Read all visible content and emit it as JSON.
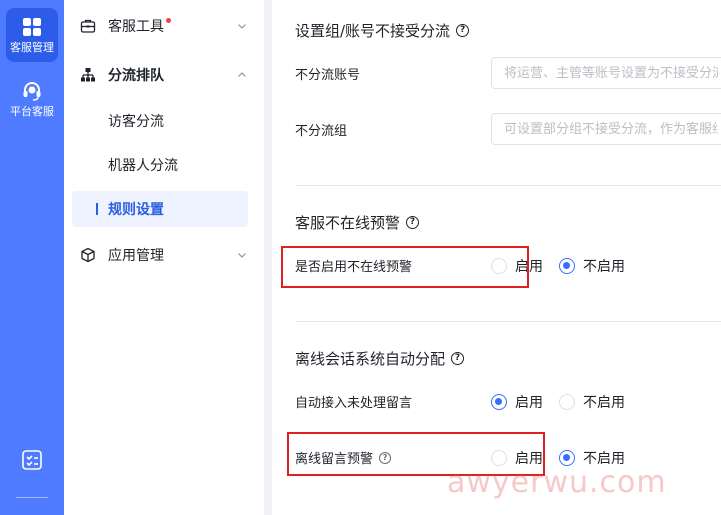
{
  "rail": {
    "items": [
      {
        "label": "客服管理",
        "icon": "apps-grid-icon",
        "active": true
      },
      {
        "label": "平台客服",
        "icon": "headset-icon",
        "active": false
      }
    ],
    "bottom_icon": "checklist-icon"
  },
  "subnav": {
    "groups": [
      {
        "label": "客服工具",
        "icon": "briefcase-icon",
        "expanded": false,
        "has_dot": true
      },
      {
        "label": "分流排队",
        "icon": "hierarchy-icon",
        "expanded": true
      },
      {
        "label": "应用管理",
        "icon": "cube-icon",
        "expanded": false
      }
    ],
    "sub_items": [
      {
        "label": "访客分流"
      },
      {
        "label": "机器人分流"
      },
      {
        "label": "规则设置",
        "active": true
      }
    ]
  },
  "main": {
    "section1": {
      "title": "设置组/账号不接受分流",
      "rows": [
        {
          "label": "不分流账号",
          "placeholder": "将运营、主管等账号设置为不接受分流"
        },
        {
          "label": "不分流组",
          "placeholder": "可设置部分组不接受分流，作为客服组"
        }
      ]
    },
    "section2": {
      "title": "客服不在线预警",
      "row": {
        "label": "是否启用不在线预警",
        "options": [
          "启用",
          "不启用"
        ],
        "selected": "不启用"
      }
    },
    "section3": {
      "title": "离线会话系统自动分配",
      "rows": [
        {
          "label": "自动接入未处理留言",
          "options": [
            "启用",
            "不启用"
          ],
          "selected": "启用"
        },
        {
          "label": "离线留言预警",
          "options": [
            "启用",
            "不启用"
          ],
          "selected": "不启用"
        }
      ]
    }
  },
  "watermark": "awyerwu.com",
  "colors": {
    "rail": "#4e7bff",
    "accent": "#3370ff",
    "highlight": "#e02020"
  }
}
